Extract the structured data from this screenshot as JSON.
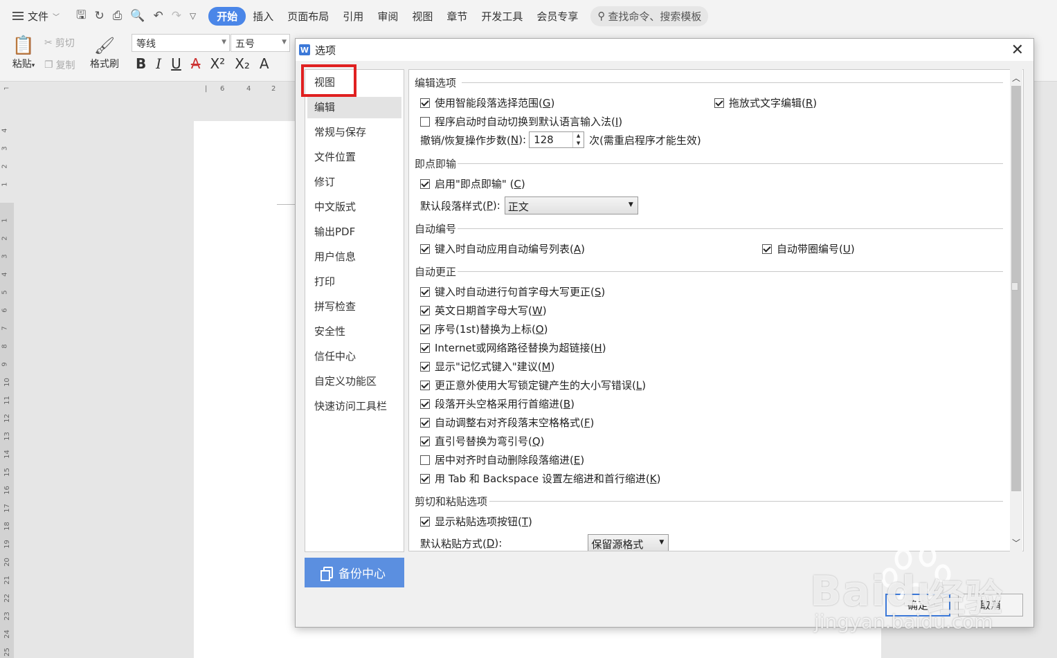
{
  "menubar": {
    "file": "文件",
    "tabs": [
      {
        "label": "开始",
        "active": true
      },
      {
        "label": "插入"
      },
      {
        "label": "页面布局"
      },
      {
        "label": "引用"
      },
      {
        "label": "审阅"
      },
      {
        "label": "视图"
      },
      {
        "label": "章节"
      },
      {
        "label": "开发工具"
      },
      {
        "label": "会员专享"
      }
    ],
    "search_placeholder": "查找命令、搜索模板"
  },
  "ribbon": {
    "paste": "粘贴",
    "cut": "剪切",
    "copy": "复制",
    "format_painter": "格式刷",
    "font_name": "等线",
    "font_size": "五号"
  },
  "dialog": {
    "title": "选项",
    "nav": [
      "视图",
      "编辑",
      "常规与保存",
      "文件位置",
      "修订",
      "中文版式",
      "输出PDF",
      "用户信息",
      "打印",
      "拼写检查",
      "安全性",
      "信任中心",
      "自定义功能区",
      "快速访问工具栏"
    ],
    "nav_selected": "编辑",
    "backup_center": "备份中心",
    "sections": {
      "edit_options": "编辑选项",
      "click_type": "即点即输",
      "auto_numbering": "自动编号",
      "auto_correct": "自动更正",
      "cut_paste": "剪切和粘贴选项"
    },
    "edit_options": {
      "smart_paragraph": {
        "label": "使用智能段落选择范围(",
        "key": "G",
        "checked": true
      },
      "drag_drop": {
        "label": "拖放式文字编辑(",
        "key": "R",
        "checked": true
      },
      "auto_ime": {
        "label": "程序启动时自动切换到默认语言输入法(",
        "key": "I",
        "checked": false
      },
      "undo_label": "撤销/恢复操作步数(",
      "undo_key": "N",
      "undo_value": "128",
      "undo_suffix": "次(需重启程序才能生效)"
    },
    "click_type": {
      "enable": {
        "label": "启用\"即点即输\" (",
        "key": "C",
        "checked": true
      },
      "default_style_label": "默认段落样式(",
      "default_style_key": "P",
      "default_style_value": "正文"
    },
    "auto_numbering": {
      "auto_list": {
        "label": "键入时自动应用自动编号列表(",
        "key": "A",
        "checked": true
      },
      "auto_circle": {
        "label": "自动带圈编号(",
        "key": "U",
        "checked": true
      }
    },
    "auto_correct": [
      {
        "label": "键入时自动进行句首字母大写更正(",
        "key": "S",
        "checked": true
      },
      {
        "label": "英文日期首字母大写(",
        "key": "W",
        "checked": true
      },
      {
        "label": "序号(1st)替换为上标(",
        "key": "O",
        "checked": true
      },
      {
        "label": "Internet或网络路径替换为超链接(",
        "key": "H",
        "checked": true
      },
      {
        "label": "显示\"记忆式键入\"建议(",
        "key": "M",
        "checked": true
      },
      {
        "label": "更正意外使用大写锁定键产生的大小写错误(",
        "key": "L",
        "checked": true
      },
      {
        "label": "段落开头空格采用行首缩进(",
        "key": "B",
        "checked": true
      },
      {
        "label": "自动调整右对齐段落末空格格式(",
        "key": "F",
        "checked": true
      },
      {
        "label": "直引号替换为弯引号(",
        "key": "Q",
        "checked": true
      },
      {
        "label": "居中对齐时自动删除段落缩进(",
        "key": "E",
        "checked": false
      },
      {
        "label": "用 Tab 和 Backspace 设置左缩进和首行缩进(",
        "key": "K",
        "checked": true
      }
    ],
    "cut_paste": {
      "show_paste_btn": {
        "label": "显示粘贴选项按钮(",
        "key": "T",
        "checked": true
      },
      "default_paste_label": "默认粘贴方式(",
      "default_paste_key": "D",
      "default_paste_value": "保留源格式"
    },
    "ok": "确定",
    "cancel": "取消"
  },
  "watermark": {
    "brand": "Bai",
    "brand2": "du",
    "cn": "经验",
    "url": "jingyan.baidu.com"
  },
  "colors": {
    "accent": "#4a86e8",
    "highlight": "#e02020",
    "backup": "#5b8fe0"
  }
}
